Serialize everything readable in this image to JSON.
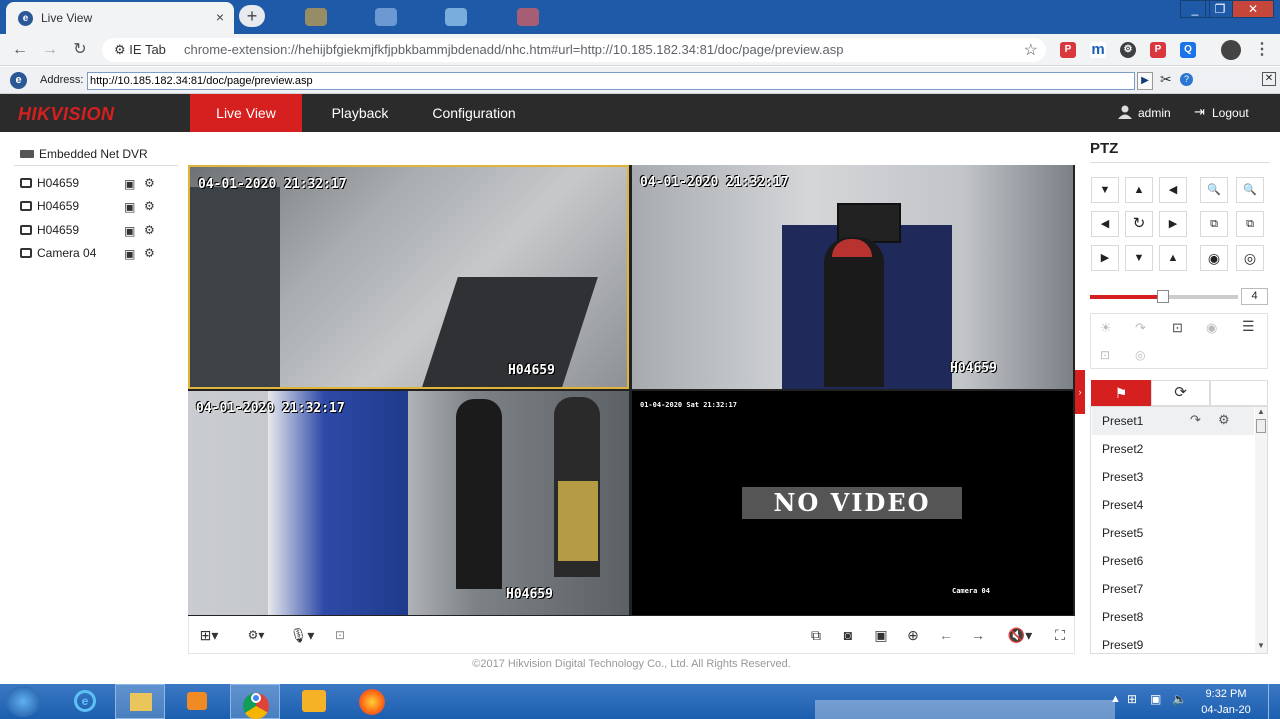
{
  "browser": {
    "tab_title": "Live View",
    "new_tab_symbol": "+",
    "tab_close": "×",
    "window_buttons": [
      "_",
      "❐",
      "✕"
    ],
    "omnibox": {
      "chip": "IE Tab",
      "url": "chrome-extension://hehijbfgiekmjfkfjpbkbammjbdenadd/nhc.htm#url=http://10.185.182.34:81/doc/page/preview.asp"
    }
  },
  "ie_bar": {
    "label": "Address:",
    "address_value": "http://10.185.182.34:81/doc/page/preview.asp"
  },
  "header": {
    "logo_hik": "HIK",
    "logo_vision": "VISION",
    "nav": [
      "Live View",
      "Playback",
      "Configuration"
    ],
    "user": "admin",
    "logout": "Logout"
  },
  "device_tree": {
    "root": "Embedded Net DVR",
    "cameras": [
      "H04659",
      "H04659",
      "H04659",
      "Camera 04"
    ]
  },
  "video": {
    "panes": [
      {
        "timestamp": "04-01-2020 21:32:17",
        "label": "H04659"
      },
      {
        "timestamp": "04-01-2020 21:32:17",
        "label": "H04659"
      },
      {
        "timestamp": "04-01-2020 21:32:17",
        "label": "H04659"
      },
      {
        "timestamp": "01-04-2020 Sat 21:32:17",
        "label": "Camera 04",
        "no_video": "NO VIDEO"
      }
    ]
  },
  "ptz": {
    "title": "PTZ",
    "speed": "4",
    "speed_fraction": 0.49,
    "presets": [
      "Preset1",
      "Preset2",
      "Preset3",
      "Preset4",
      "Preset5",
      "Preset6",
      "Preset7",
      "Preset8",
      "Preset9"
    ]
  },
  "footer": {
    "copyright": "©2017 Hikvision Digital Technology Co., Ltd. All Rights Reserved."
  },
  "taskbar": {
    "time": "9:32 PM",
    "date": "04-Jan-20"
  },
  "colors": {
    "accent": "#d5201f",
    "header_bg": "#2b2b2b",
    "taskbar": "#1c5faf",
    "chrome_tabstrip": "#1e5aa8"
  }
}
